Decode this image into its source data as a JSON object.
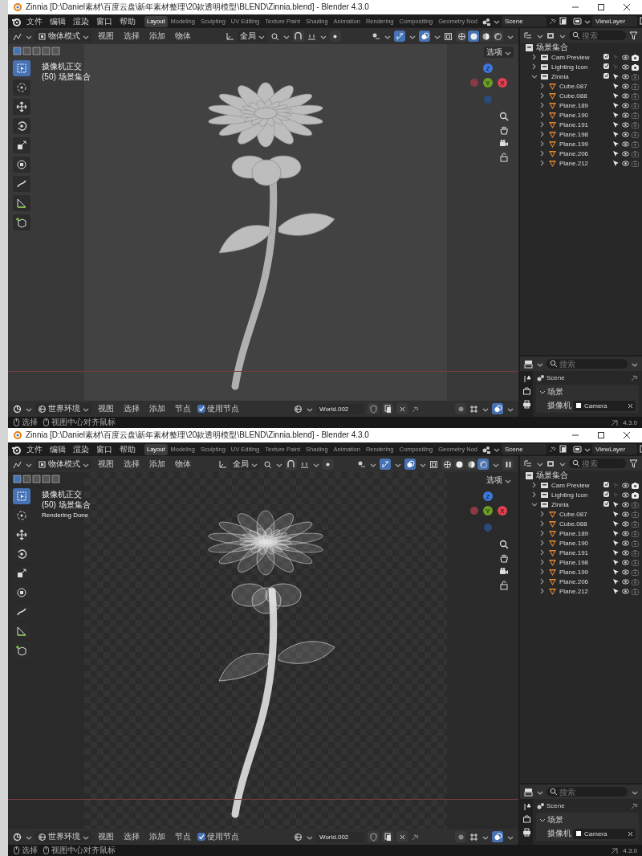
{
  "windows": [
    {
      "title": "Zinnia [D:\\Daniel素材\\百度云盘\\新年素材整理\\20款透明模型\\BLEND\\Zinnia.blend] - Blender 4.3.0",
      "menus": [
        "文件",
        "编辑",
        "渲染",
        "窗口",
        "帮助"
      ],
      "workspaces": [
        {
          "label": "Layout",
          "selected": true
        },
        {
          "label": "Modeling",
          "selected": false
        },
        {
          "label": "Sculpting",
          "selected": false
        },
        {
          "label": "UV Editing",
          "selected": false
        },
        {
          "label": "Texture Paint",
          "selected": false
        },
        {
          "label": "Shading",
          "selected": false
        },
        {
          "label": "Animation",
          "selected": false
        },
        {
          "label": "Rendering",
          "selected": false
        },
        {
          "label": "Compositing",
          "selected": false
        },
        {
          "label": "Geometry Nod",
          "selected": false
        }
      ],
      "scene": "Scene",
      "view_layer": "ViewLayer",
      "viewport": {
        "kind": "solid",
        "mode": "物体模式",
        "menus": [
          "视图",
          "选择",
          "添加",
          "物体"
        ],
        "orientation": "全局",
        "options": "选项",
        "shading_modes": [
          {
            "selected": false
          },
          {
            "selected": true
          },
          {
            "selected": false
          },
          {
            "selected": false
          }
        ],
        "tools": [
          {
            "kind": "select",
            "selected": true
          },
          {
            "kind": "cursor",
            "selected": false
          },
          {
            "kind": "move",
            "selected": false
          },
          {
            "kind": "rotate",
            "selected": false
          },
          {
            "kind": "scale",
            "selected": false
          },
          {
            "kind": "transform",
            "selected": false
          },
          {
            "kind": "annotate",
            "selected": false
          },
          {
            "kind": "measure",
            "selected": false
          },
          {
            "kind": "add_cube",
            "selected": false
          }
        ],
        "overlay_lines": [
          "摄像机正交",
          "(50) 场景集合"
        ],
        "gizmo_axes": [
          {
            "label": "Z",
            "color": "#3b78e0"
          },
          {
            "label": "Y",
            "color": "#6a9d23"
          },
          {
            "label": "X",
            "color": "#e0404f"
          }
        ]
      },
      "outliner": {
        "search_placeholder": "搜索",
        "root": {
          "label": "场景集合",
          "children": [
            {
              "kind": "collection",
              "label": "Cam Preview",
              "expanded": false,
              "checked": true,
              "selectable": false,
              "renderable": true
            },
            {
              "kind": "collection",
              "label": "Lighting Icon",
              "expanded": false,
              "checked": true,
              "selectable": false,
              "renderable": true
            },
            {
              "kind": "collection",
              "label": "Zinnia",
              "expanded": true,
              "checked": true,
              "selectable": true,
              "renderable": false,
              "children": [
                {
                  "kind": "mesh",
                  "label": "Cube.087",
                  "expanded": false,
                  "selectable": true,
                  "renderable": false
                },
                {
                  "kind": "mesh",
                  "label": "Cube.088",
                  "expanded": false,
                  "selectable": true,
                  "renderable": false
                },
                {
                  "kind": "mesh",
                  "label": "Plane.189",
                  "expanded": false,
                  "selectable": true,
                  "renderable": false
                },
                {
                  "kind": "mesh",
                  "label": "Plane.190",
                  "expanded": false,
                  "selectable": true,
                  "renderable": false
                },
                {
                  "kind": "mesh",
                  "label": "Plane.191",
                  "expanded": false,
                  "selectable": true,
                  "renderable": false
                },
                {
                  "kind": "mesh",
                  "label": "Plane.198",
                  "expanded": false,
                  "selectable": true,
                  "renderable": false
                },
                {
                  "kind": "mesh",
                  "label": "Plane.199",
                  "expanded": false,
                  "selectable": true,
                  "renderable": false
                },
                {
                  "kind": "mesh",
                  "label": "Plane.206",
                  "expanded": false,
                  "selectable": true,
                  "renderable": false
                },
                {
                  "kind": "mesh",
                  "label": "Plane.212",
                  "expanded": false,
                  "selectable": true,
                  "renderable": false
                }
              ]
            }
          ]
        }
      },
      "node_editor": {
        "type": "世界环境",
        "menus": [
          "视图",
          "选择",
          "添加",
          "节点"
        ],
        "use_nodes": {
          "label": "使用节点",
          "checked": true
        },
        "world": "World.002"
      },
      "properties": {
        "search_placeholder": "搜索",
        "scene": "Scene",
        "panel": {
          "label": "场景",
          "expanded": true
        },
        "camera_label": "摄像机",
        "camera": "Camera"
      },
      "status": {
        "hints": [
          "选择",
          "视图中心对齐鼠标"
        ],
        "version": "4.3.0"
      }
    },
    {
      "title": "Zinnia [D:\\Daniel素材\\百度云盘\\新年素材整理\\20款透明模型\\BLEND\\Zinnia.blend] - Blender 4.3.0",
      "menus": [
        "文件",
        "编辑",
        "渲染",
        "窗口",
        "帮助"
      ],
      "workspaces": [
        {
          "label": "Layout",
          "selected": true
        },
        {
          "label": "Modeling",
          "selected": false
        },
        {
          "label": "Sculpting",
          "selected": false
        },
        {
          "label": "UV Editing",
          "selected": false
        },
        {
          "label": "Texture Paint",
          "selected": false
        },
        {
          "label": "Shading",
          "selected": false
        },
        {
          "label": "Animation",
          "selected": false
        },
        {
          "label": "Rendering",
          "selected": false
        },
        {
          "label": "Compositing",
          "selected": false
        },
        {
          "label": "Geometry Nod",
          "selected": false
        }
      ],
      "scene": "Scene",
      "view_layer": "ViewLayer",
      "viewport": {
        "kind": "rendered",
        "mode": "物体模式",
        "menus": [
          "视图",
          "选择",
          "添加",
          "物体"
        ],
        "orientation": "全局",
        "options": "选项",
        "shading_modes": [
          {
            "selected": false
          },
          {
            "selected": false
          },
          {
            "selected": false
          },
          {
            "selected": true
          }
        ],
        "tools": [
          {
            "kind": "select",
            "selected": true
          },
          {
            "kind": "cursor",
            "selected": false
          },
          {
            "kind": "move",
            "selected": false
          },
          {
            "kind": "rotate",
            "selected": false
          },
          {
            "kind": "scale",
            "selected": false
          },
          {
            "kind": "transform",
            "selected": false
          },
          {
            "kind": "annotate",
            "selected": false
          },
          {
            "kind": "measure",
            "selected": false
          },
          {
            "kind": "add_cube",
            "selected": false
          }
        ],
        "overlay_lines": [
          "摄像机正交",
          "(50) 场景集合",
          "Rendering Done"
        ],
        "gizmo_axes": [
          {
            "label": "Z",
            "color": "#3b78e0"
          },
          {
            "label": "Y",
            "color": "#6a9d23"
          },
          {
            "label": "X",
            "color": "#e0404f"
          }
        ]
      },
      "outliner": {
        "search_placeholder": "搜索",
        "root": {
          "label": "场景集合",
          "children": [
            {
              "kind": "collection",
              "label": "Cam Preview",
              "expanded": false,
              "checked": true,
              "selectable": false,
              "renderable": true
            },
            {
              "kind": "collection",
              "label": "Lighting Icon",
              "expanded": false,
              "checked": true,
              "selectable": false,
              "renderable": true
            },
            {
              "kind": "collection",
              "label": "Zinnia",
              "expanded": true,
              "checked": true,
              "selectable": true,
              "renderable": false,
              "children": [
                {
                  "kind": "mesh",
                  "label": "Cube.087",
                  "expanded": false,
                  "selectable": true,
                  "renderable": false
                },
                {
                  "kind": "mesh",
                  "label": "Cube.088",
                  "expanded": false,
                  "selectable": true,
                  "renderable": false
                },
                {
                  "kind": "mesh",
                  "label": "Plane.189",
                  "expanded": false,
                  "selectable": true,
                  "renderable": false
                },
                {
                  "kind": "mesh",
                  "label": "Plane.190",
                  "expanded": false,
                  "selectable": true,
                  "renderable": false
                },
                {
                  "kind": "mesh",
                  "label": "Plane.191",
                  "expanded": false,
                  "selectable": true,
                  "renderable": false
                },
                {
                  "kind": "mesh",
                  "label": "Plane.198",
                  "expanded": false,
                  "selectable": true,
                  "renderable": false
                },
                {
                  "kind": "mesh",
                  "label": "Plane.199",
                  "expanded": false,
                  "selectable": true,
                  "renderable": false
                },
                {
                  "kind": "mesh",
                  "label": "Plane.206",
                  "expanded": false,
                  "selectable": true,
                  "renderable": false
                },
                {
                  "kind": "mesh",
                  "label": "Plane.212",
                  "expanded": false,
                  "selectable": true,
                  "renderable": false
                }
              ]
            }
          ]
        }
      },
      "node_editor": {
        "type": "世界环境",
        "menus": [
          "视图",
          "选择",
          "添加",
          "节点"
        ],
        "use_nodes": {
          "label": "使用节点",
          "checked": true
        },
        "world": "World.002"
      },
      "properties": {
        "search_placeholder": "搜索",
        "scene": "Scene",
        "panel": {
          "label": "场景",
          "expanded": true
        },
        "camera_label": "摄像机",
        "camera": "Camera"
      },
      "status": {
        "hints": [
          "选择",
          "视图中心对齐鼠标"
        ],
        "version": "4.3.0"
      }
    }
  ]
}
